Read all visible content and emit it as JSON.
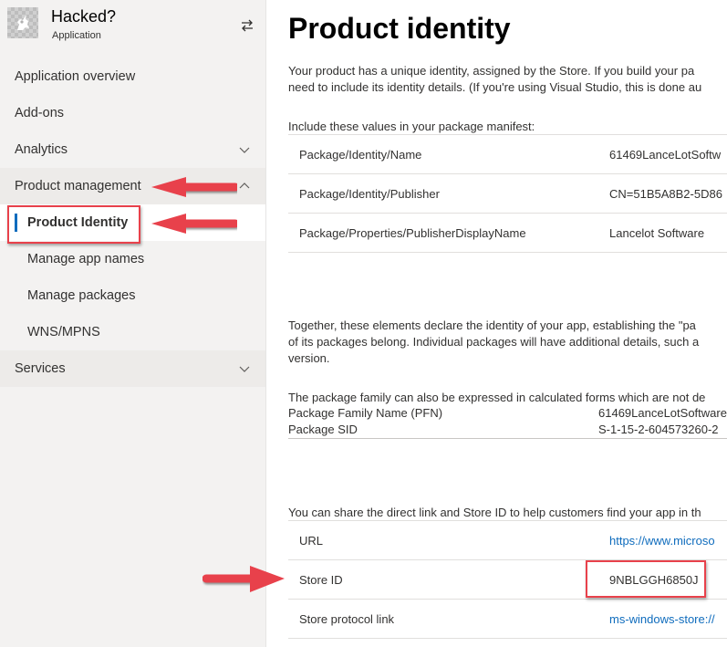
{
  "app": {
    "title": "Hacked?",
    "subtitle": "Application",
    "logo_icon": "knight-logo",
    "switch_icon": "switch-arrows-icon"
  },
  "sidebar": {
    "items": [
      {
        "label": "Application overview",
        "chevron": null
      },
      {
        "label": "Add-ons",
        "chevron": null
      },
      {
        "label": "Analytics",
        "chevron": "down"
      },
      {
        "label": "Product management",
        "chevron": "up",
        "expanded": true,
        "children": [
          {
            "label": "Product Identity",
            "selected": true
          },
          {
            "label": "Manage app names"
          },
          {
            "label": "Manage packages"
          },
          {
            "label": "WNS/MPNS"
          }
        ]
      },
      {
        "label": "Services",
        "chevron": "down"
      }
    ]
  },
  "main": {
    "title": "Product identity",
    "intro_line1": "Your product has a unique identity, assigned by the Store. If you build your pa",
    "intro_line2": "need to include its identity details. (If you're using Visual Studio, this is done au",
    "manifest_label": "Include these values in your package manifest:",
    "manifest_rows": [
      {
        "key": "Package/Identity/Name",
        "value": "61469LanceLotSoftw"
      },
      {
        "key": "Package/Identity/Publisher",
        "value": "CN=51B5A8B2-5D86"
      },
      {
        "key": "Package/Properties/PublisherDisplayName",
        "value": "Lancelot Software"
      }
    ],
    "together_line1": "Together, these elements declare the identity of your app, establishing the \"pa",
    "together_line2": "of its packages belong. Individual packages will have additional details, such a",
    "together_line3": "version.",
    "calc_label": "The package family can also be expressed in calculated forms which are not de",
    "calc_rows": [
      {
        "key": "Package Family Name (PFN)",
        "value": "61469LanceLotSoftware"
      },
      {
        "key": "Package SID",
        "value": "S-1-15-2-604573260-2"
      }
    ],
    "share_label": "You can share the direct link and Store ID to help customers find your app in th",
    "share_rows": [
      {
        "key": "URL",
        "value": "https://www.microso",
        "link": true
      },
      {
        "key": "Store ID",
        "value": "9NBLGGH6850J",
        "link": false
      },
      {
        "key": "Store protocol link",
        "value": "ms-windows-store://",
        "link": true
      }
    ]
  },
  "annotations": {
    "color": "#e8414b",
    "highlight_color": "#0f6cbd"
  }
}
